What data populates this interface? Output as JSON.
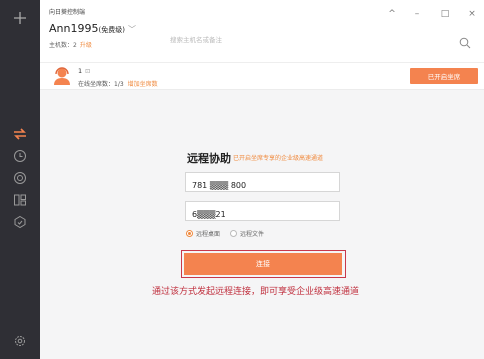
{
  "sidebar": {
    "icons": [
      "plus-icon",
      "transfer-icon",
      "clock-icon",
      "globe-icon",
      "devices-icon",
      "shield-icon",
      "settings-icon"
    ]
  },
  "titlebar": {
    "app_name": "向日葵控制端",
    "user_name": "Ann1995",
    "user_level": "(免费级)",
    "host_count_label": "主机数：2",
    "upgrade_label": "升级",
    "search_placeholder": "搜索主机名或备注",
    "window_controls": [
      "^",
      "–",
      "□",
      "×"
    ]
  },
  "seat_bar": {
    "count": "1",
    "edit_icon": "⊡",
    "seat_info": "在线坐席数：1/3",
    "add_seat_link": "增加坐席数",
    "enterprise_button": "已开启坐席"
  },
  "remote_assist": {
    "title": "远程协助",
    "subtitle": "已开启坐席专享的企业级高速通道",
    "id_value": "781 ▒▒▒ 800",
    "code_value": "6▒▒▒21",
    "mode_options": [
      {
        "label": "远程桌面",
        "selected": true
      },
      {
        "label": "远程文件",
        "selected": false
      }
    ],
    "connect_label": "连接",
    "note": "通过该方式发起远程连接，即可享受企业级高速通道"
  },
  "colors": {
    "accent": "#f4834f",
    "sidebar_bg": "#2f2f35",
    "highlight_frame": "#c8384b",
    "note_text": "#c0303e"
  }
}
